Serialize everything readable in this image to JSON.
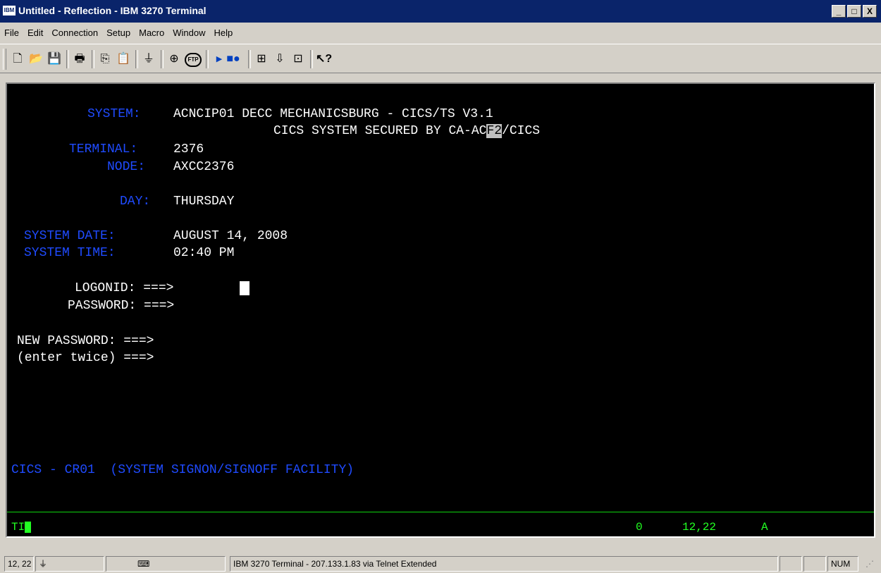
{
  "window": {
    "title": "Untitled - Reflection - IBM 3270 Terminal",
    "app_icon": "IBM",
    "buttons": [
      "_",
      "□",
      "X"
    ]
  },
  "menu": [
    "File",
    "Edit",
    "Connection",
    "Setup",
    "Macro",
    "Window",
    "Help"
  ],
  "toolbar": {
    "icons": [
      "new-icon",
      "open-icon",
      "save-icon",
      "print-icon",
      "copy-icon",
      "paste-icon",
      "connect-icon",
      "options-icon",
      "ftp-icon",
      "play-macro-icon",
      "record-macro-icon",
      "setup-icon",
      "download-icon",
      "upload-icon",
      "help-pointer-icon"
    ],
    "ftp_label": "FTP"
  },
  "screen": {
    "system_label": "SYSTEM:",
    "system_value": "ACNCIP01 DECC MECHANICSBURG - CICS/TS V3.1",
    "secured_pre": "CICS SYSTEM SECURED BY CA-AC",
    "secured_hl": "F2",
    "secured_post": "/CICS",
    "terminal_label": "TERMINAL:",
    "terminal_value": "2376",
    "node_label": "NODE:",
    "node_value": "AXCC2376",
    "day_label": "DAY:",
    "day_value": "THURSDAY",
    "date_label": "SYSTEM DATE:",
    "date_value": "AUGUST 14, 2008",
    "time_label": "SYSTEM TIME:",
    "time_value": "02:40 PM",
    "logonid": "LOGONID: ===>",
    "password": "PASSWORD: ===>",
    "new_password": "NEW PASSWORD: ===>",
    "enter_twice": "(enter twice) ===>",
    "footer": "CICS - CR01  (SYSTEM SIGNON/SIGNOFF FACILITY)"
  },
  "oia": {
    "left": "TI",
    "count": "0",
    "position": "12,22",
    "mode": "A"
  },
  "status": {
    "cursor": "12, 22",
    "session": "IBM 3270 Terminal - 207.133.1.83 via Telnet Extended",
    "num": "NUM"
  }
}
